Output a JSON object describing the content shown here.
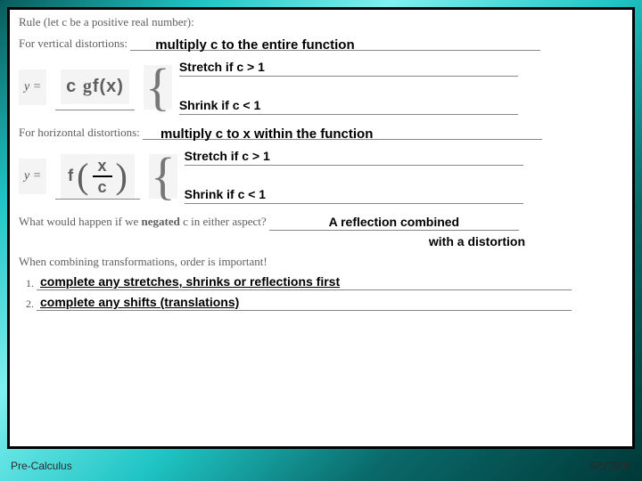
{
  "footer": {
    "left": "Pre-Calculus",
    "right": "9/5/2006"
  },
  "rule_heading": "Rule (let c be a positive real number):",
  "vert": {
    "label": "For vertical distortions: ",
    "answer": "multiply c to the entire function",
    "yeq": "y =",
    "formula_c": "c",
    "formula_g": "g",
    "formula_fx": "f(x)",
    "stretch": "Stretch if c > 1",
    "shrink": "Shrink if c < 1"
  },
  "horiz": {
    "label": "For horizontal distortions: ",
    "answer": "multiply c to x within the function",
    "yeq": "y =",
    "formula_f": "f",
    "formula_x": "x",
    "formula_c": "c",
    "stretch": "Stretch if c > 1",
    "shrink": "Shrink if c < 1"
  },
  "negated": {
    "question_pre": "What would happen if we ",
    "question_bold": "negated",
    "question_post": " c in either aspect? ",
    "answer_line1": "A reflection combined",
    "answer_line2": "with a distortion"
  },
  "combine_note": "When combining transformations, order is important!",
  "steps": {
    "s1": "complete any stretches, shrinks or reflections first",
    "s2": "complete any shifts (translations)"
  }
}
